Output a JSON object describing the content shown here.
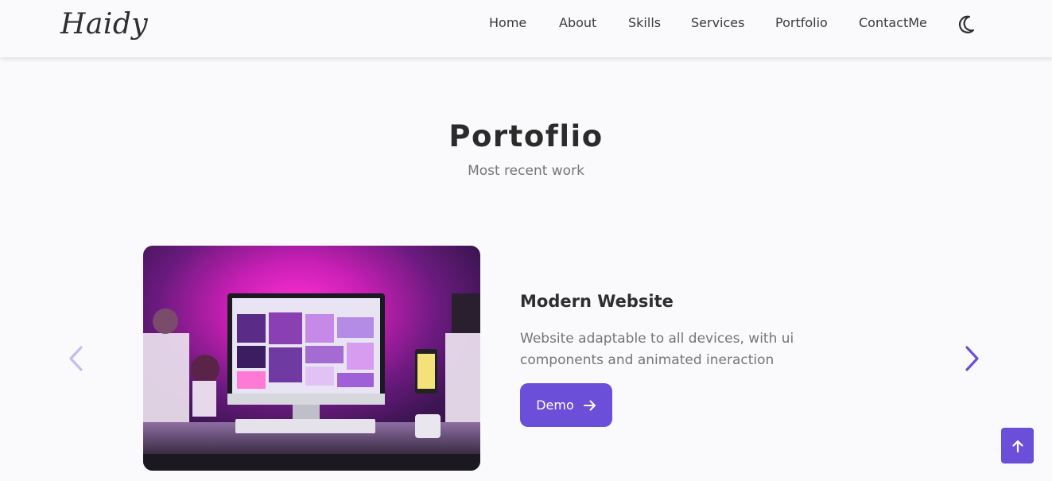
{
  "header": {
    "logo": "Haidy",
    "nav": [
      "Home",
      "About",
      "Skills",
      "Services",
      "Portfolio",
      "ContactMe"
    ],
    "theme_icon": "moon-icon"
  },
  "section": {
    "title": "Portoflio",
    "subtitle": "Most recent work"
  },
  "slide": {
    "title": "Modern Website",
    "description": "Website adaptable to all devices, with ui components and animated ineraction",
    "button_label": "Demo",
    "button_icon": "arrow-right-icon",
    "image_icon": "desktop-setup-image"
  },
  "controls": {
    "prev_icon": "chevron-left-icon",
    "next_icon": "chevron-right-icon",
    "scroll_up_icon": "arrow-up-icon"
  },
  "colors": {
    "accent": "#6c4fd9",
    "arrow_disabled": "#c7bcef",
    "background": "#fafafc"
  }
}
